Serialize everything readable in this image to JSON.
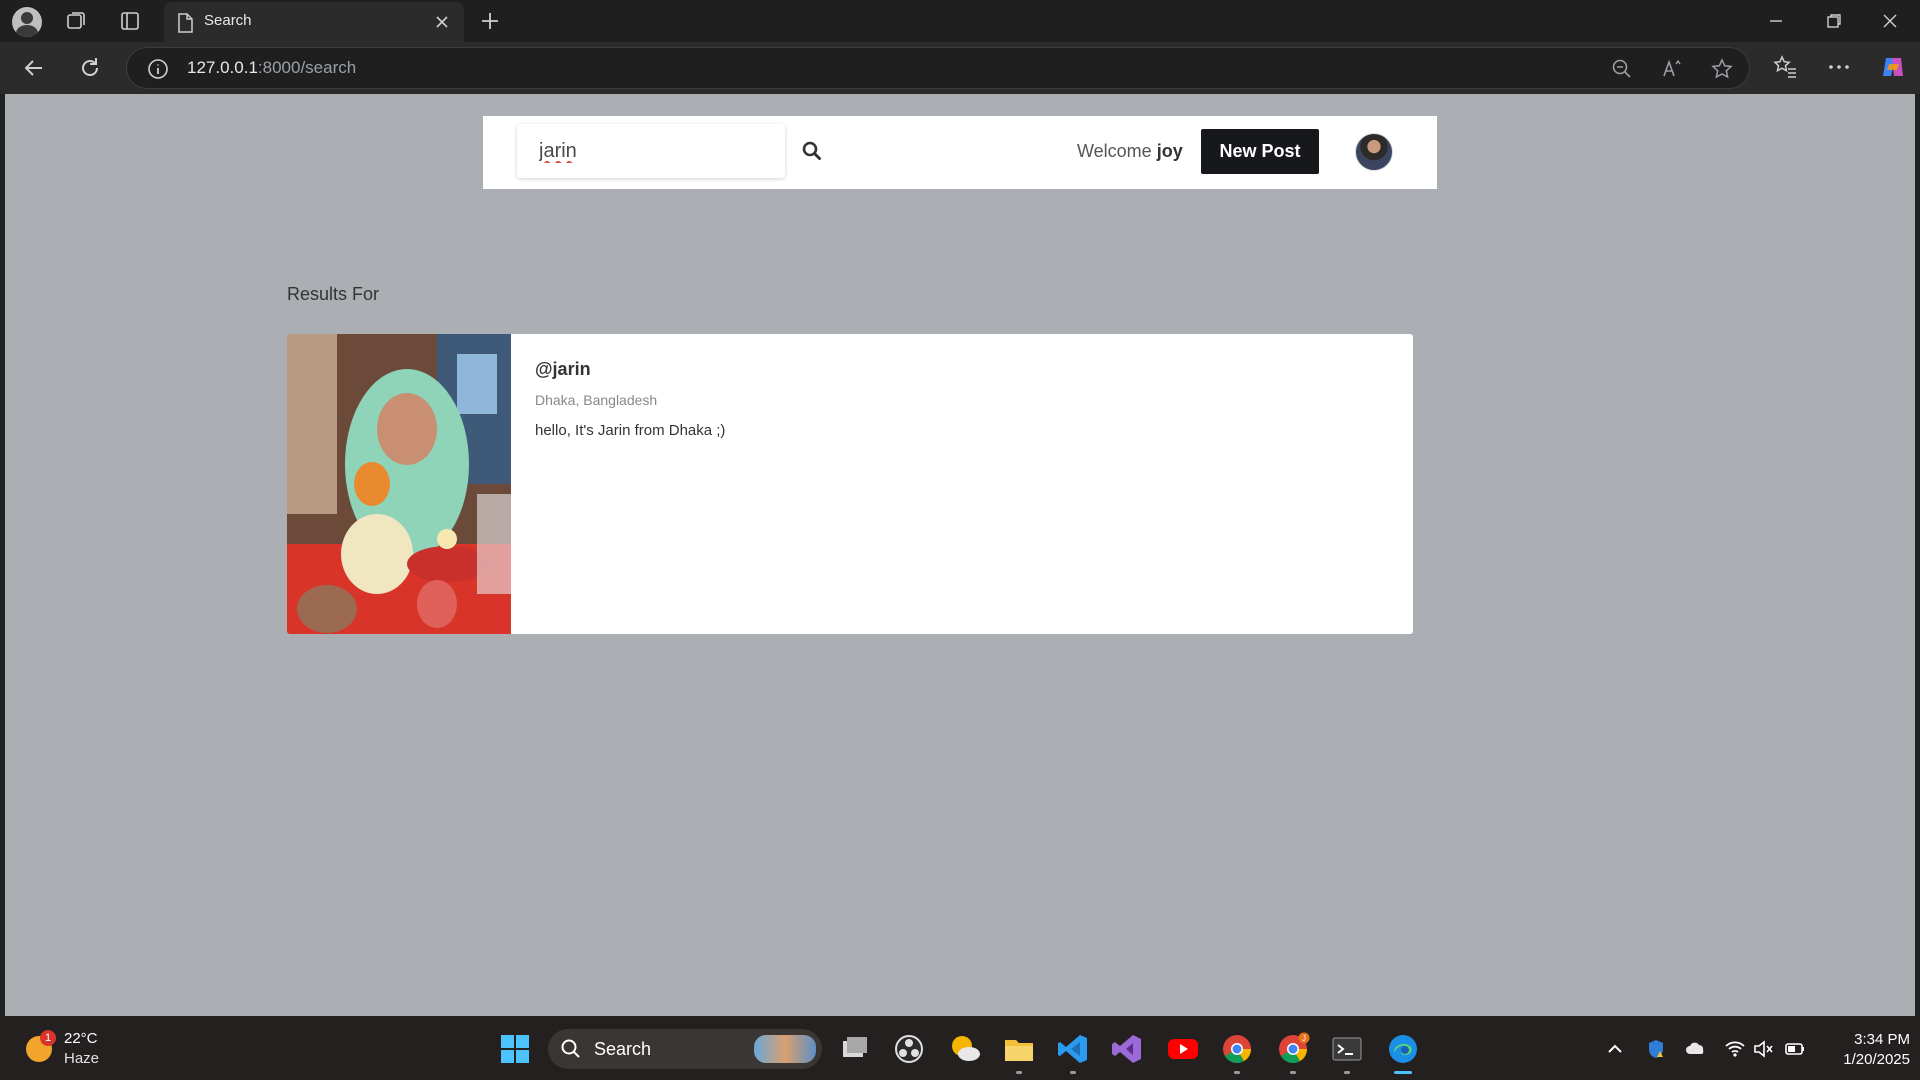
{
  "browser": {
    "tab_title": "Search",
    "url_host": "127.0.0.1",
    "url_path": ":8000/search"
  },
  "page": {
    "search": {
      "value": "jarin",
      "placeholder": ""
    },
    "welcome_prefix": "Welcome",
    "welcome_user": "joy",
    "new_post_label": "New Post",
    "results_label": "Results For",
    "results": [
      {
        "username": "@jarin",
        "location": "Dhaka, Bangladesh",
        "bio": "hello, It's Jarin from Dhaka ;)"
      }
    ]
  },
  "taskbar": {
    "weather_badge": "1",
    "temperature": "22°C",
    "condition": "Haze",
    "search_label": "Search",
    "chrome_badge": "J",
    "time": "3:34 PM",
    "date": "1/20/2025"
  },
  "colors": {
    "page_background": "#abafb4",
    "new_post_button": "#17181c",
    "active_indicator": "#4cc2ff"
  }
}
